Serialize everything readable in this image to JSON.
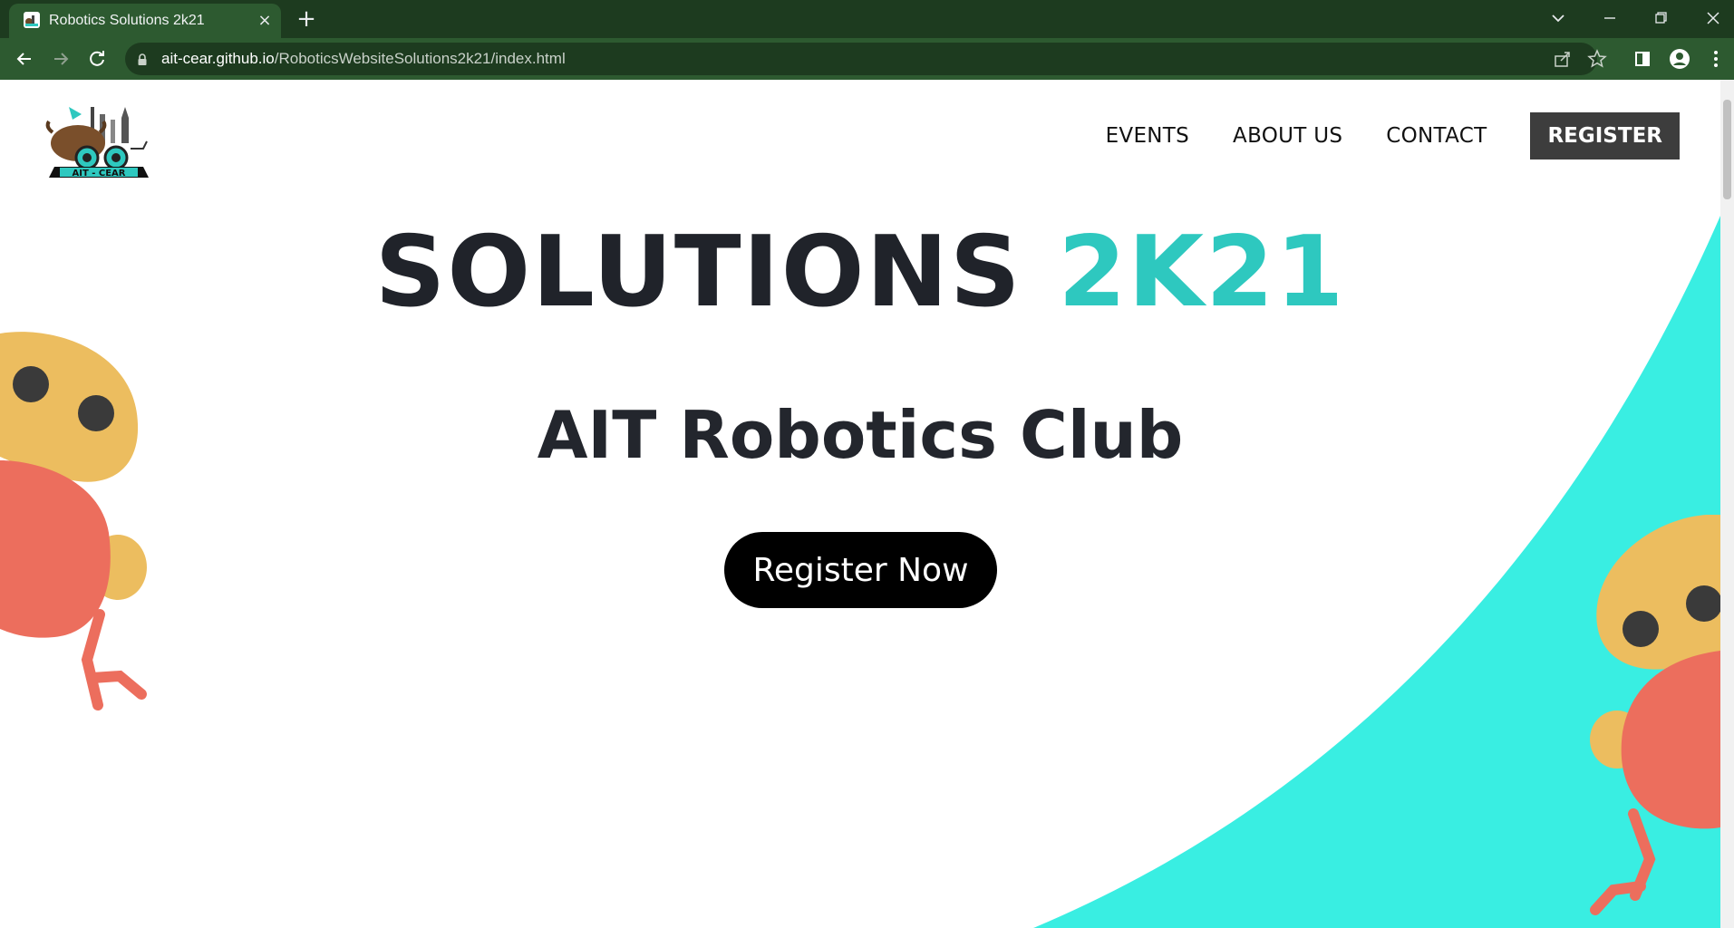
{
  "browser": {
    "tab_title": "Robotics Solutions 2k21",
    "tab_close": "×",
    "new_tab": "+",
    "url_host": "ait-cear.github.io",
    "url_path": "/RoboticsWebsiteSolutions2k21/index.html",
    "theme_dark": "#1d3b1f",
    "theme_light": "#2d5a30"
  },
  "nav": {
    "items": [
      {
        "label": "EVENTS"
      },
      {
        "label": "ABOUT US"
      },
      {
        "label": "CONTACT"
      }
    ],
    "register_label": "REGISTER"
  },
  "logo": {
    "text": "AIT - CEAR"
  },
  "hero": {
    "title_main": "SOLUTIONS",
    "title_accent": "2K21",
    "subtitle": "AIT Robotics Club",
    "cta_label": "Register Now",
    "accent_color": "#2ec8bf",
    "shape_color": "#39eee2"
  }
}
